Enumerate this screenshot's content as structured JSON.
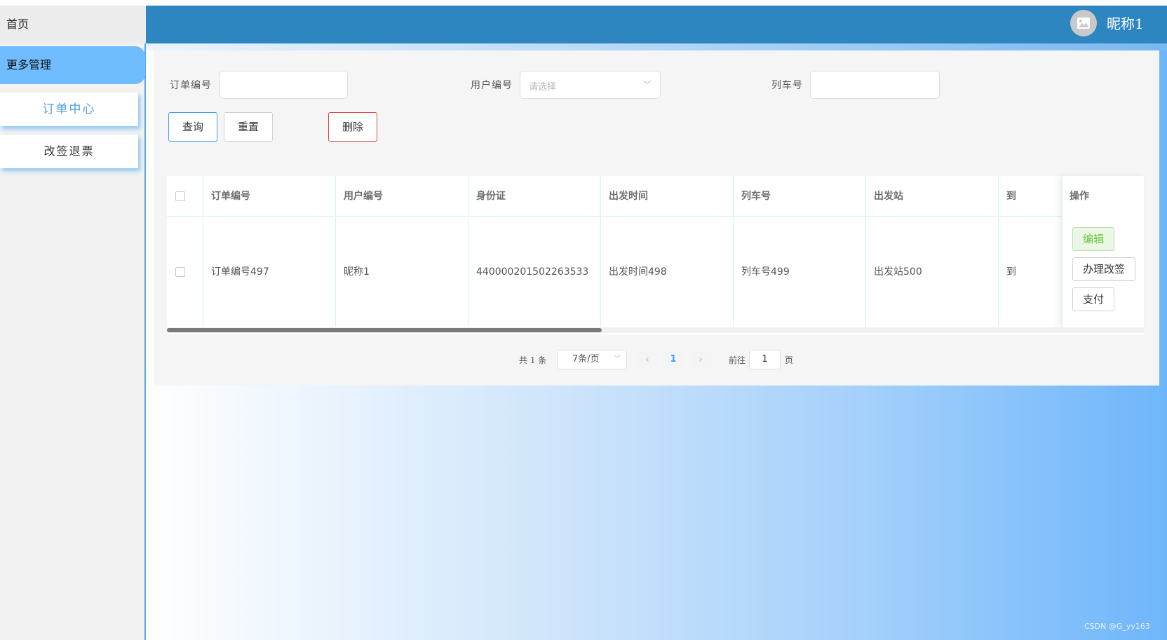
{
  "sidebar": {
    "home": "首页",
    "more": "更多管理",
    "sub1": "订单中心",
    "sub2": "改签退票"
  },
  "header": {
    "nickname": "昵称1"
  },
  "filters": {
    "order_label": "订单编号",
    "user_label": "用户编号",
    "user_placeholder": "请选择",
    "train_label": "列车号"
  },
  "buttons": {
    "query": "查询",
    "reset": "重置",
    "delete": "删除"
  },
  "table": {
    "headers": [
      "订单编号",
      "用户编号",
      "身份证",
      "出发时间",
      "列车号",
      "出发站",
      "到"
    ],
    "ops_header": "操作",
    "row": [
      "订单编号497",
      "昵称1",
      "440000201502263533",
      "出发时间498",
      "列车号499",
      "出发站500",
      "到"
    ],
    "ops": [
      "编辑",
      "办理改签",
      "支付"
    ]
  },
  "pagination": {
    "total": "共 1 条",
    "page_size": "7条/页",
    "prev": "‹",
    "current": "1",
    "next": "›",
    "goto_label": "前往",
    "goto_value": "1",
    "page_suffix": "页"
  },
  "watermark": "CSDN @G_yy163",
  "colors": {
    "topbar": "#2e86c1",
    "active_menu": "#6fbcff",
    "accent": "#409eff"
  }
}
